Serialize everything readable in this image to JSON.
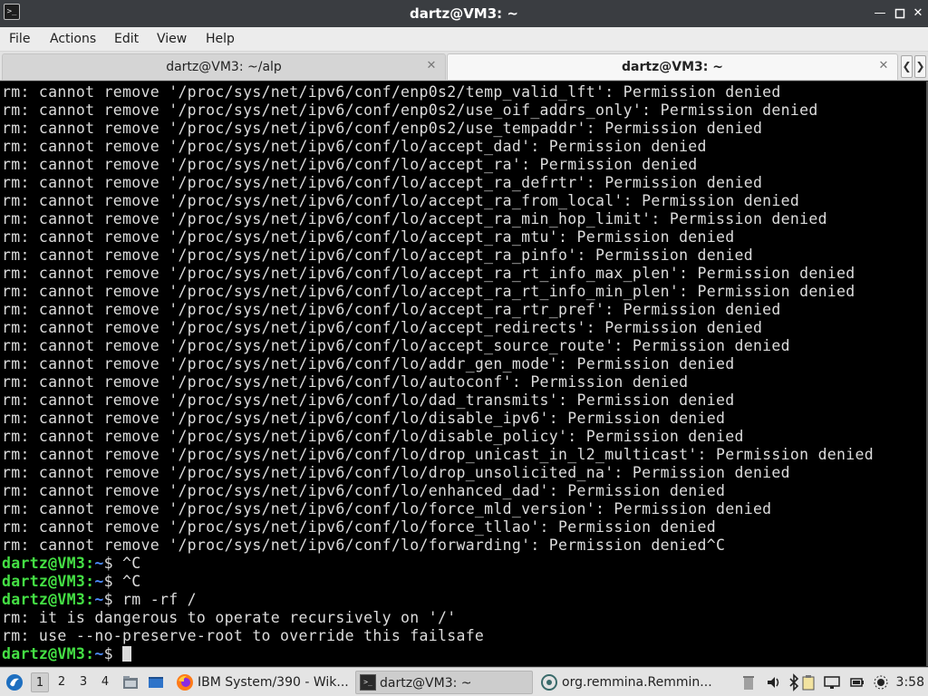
{
  "window": {
    "title": "dartz@VM3: ~",
    "app_icon": "terminal-icon",
    "buttons": [
      "minimize-icon",
      "maximize-icon",
      "close-icon"
    ]
  },
  "menu": [
    "File",
    "Actions",
    "Edit",
    "View",
    "Help"
  ],
  "tabs": [
    {
      "label": "dartz@VM3: ~/alp",
      "active": false
    },
    {
      "label": "dartz@VM3: ~",
      "active": true
    }
  ],
  "terminal": {
    "colors": {
      "background": "#000000",
      "text": "#dcdcdc",
      "prompt_user": "#44e044",
      "prompt_path": "#4d8cff"
    },
    "output_lines": [
      "rm: cannot remove '/proc/sys/net/ipv6/conf/enp0s2/temp_valid_lft': Permission denied",
      "rm: cannot remove '/proc/sys/net/ipv6/conf/enp0s2/use_oif_addrs_only': Permission denied",
      "rm: cannot remove '/proc/sys/net/ipv6/conf/enp0s2/use_tempaddr': Permission denied",
      "rm: cannot remove '/proc/sys/net/ipv6/conf/lo/accept_dad': Permission denied",
      "rm: cannot remove '/proc/sys/net/ipv6/conf/lo/accept_ra': Permission denied",
      "rm: cannot remove '/proc/sys/net/ipv6/conf/lo/accept_ra_defrtr': Permission denied",
      "rm: cannot remove '/proc/sys/net/ipv6/conf/lo/accept_ra_from_local': Permission denied",
      "rm: cannot remove '/proc/sys/net/ipv6/conf/lo/accept_ra_min_hop_limit': Permission denied",
      "rm: cannot remove '/proc/sys/net/ipv6/conf/lo/accept_ra_mtu': Permission denied",
      "rm: cannot remove '/proc/sys/net/ipv6/conf/lo/accept_ra_pinfo': Permission denied",
      "rm: cannot remove '/proc/sys/net/ipv6/conf/lo/accept_ra_rt_info_max_plen': Permission denied",
      "rm: cannot remove '/proc/sys/net/ipv6/conf/lo/accept_ra_rt_info_min_plen': Permission denied",
      "rm: cannot remove '/proc/sys/net/ipv6/conf/lo/accept_ra_rtr_pref': Permission denied",
      "rm: cannot remove '/proc/sys/net/ipv6/conf/lo/accept_redirects': Permission denied",
      "rm: cannot remove '/proc/sys/net/ipv6/conf/lo/accept_source_route': Permission denied",
      "rm: cannot remove '/proc/sys/net/ipv6/conf/lo/addr_gen_mode': Permission denied",
      "rm: cannot remove '/proc/sys/net/ipv6/conf/lo/autoconf': Permission denied",
      "rm: cannot remove '/proc/sys/net/ipv6/conf/lo/dad_transmits': Permission denied",
      "rm: cannot remove '/proc/sys/net/ipv6/conf/lo/disable_ipv6': Permission denied",
      "rm: cannot remove '/proc/sys/net/ipv6/conf/lo/disable_policy': Permission denied",
      "rm: cannot remove '/proc/sys/net/ipv6/conf/lo/drop_unicast_in_l2_multicast': Permission denied",
      "rm: cannot remove '/proc/sys/net/ipv6/conf/lo/drop_unsolicited_na': Permission denied",
      "rm: cannot remove '/proc/sys/net/ipv6/conf/lo/enhanced_dad': Permission denied",
      "rm: cannot remove '/proc/sys/net/ipv6/conf/lo/force_mld_version': Permission denied",
      "rm: cannot remove '/proc/sys/net/ipv6/conf/lo/force_tllao': Permission denied",
      "rm: cannot remove '/proc/sys/net/ipv6/conf/lo/forwarding': Permission denied^C"
    ],
    "session": [
      {
        "type": "prompt",
        "user": "dartz@VM3",
        "path": "~",
        "cmd": "^C"
      },
      {
        "type": "prompt",
        "user": "dartz@VM3",
        "path": "~",
        "cmd": "^C"
      },
      {
        "type": "prompt",
        "user": "dartz@VM3",
        "path": "~",
        "cmd": "rm -rf /"
      },
      {
        "type": "output",
        "text": "rm: it is dangerous to operate recursively on '/'"
      },
      {
        "type": "output",
        "text": "rm: use --no-preserve-root to override this failsafe"
      },
      {
        "type": "prompt",
        "user": "dartz@VM3",
        "path": "~",
        "cmd": "",
        "cursor": true
      }
    ]
  },
  "taskbar": {
    "start_icon": "start-menu-icon",
    "workspaces": [
      {
        "label": "1",
        "active": true
      },
      {
        "label": "2",
        "active": false
      },
      {
        "label": "3",
        "active": false
      },
      {
        "label": "4",
        "active": false
      }
    ],
    "quick_launch": [
      "file-manager-icon",
      "show-desktop-icon",
      "firefox-icon"
    ],
    "tasks": [
      {
        "label": "IBM System/390 - Wik...",
        "icon": "firefox-icon",
        "active": false
      },
      {
        "label": "dartz@VM3: ~",
        "icon": "terminal-icon",
        "active": true
      },
      {
        "label": "org.remmina.Remmin...",
        "icon": "remmina-icon",
        "active": false
      }
    ],
    "tray": [
      "trash-icon",
      "volume-icon",
      "bluetooth-icon",
      "clipboard-icon",
      "network-icon",
      "power-icon",
      "brightness-icon"
    ],
    "clock": "3:58"
  }
}
